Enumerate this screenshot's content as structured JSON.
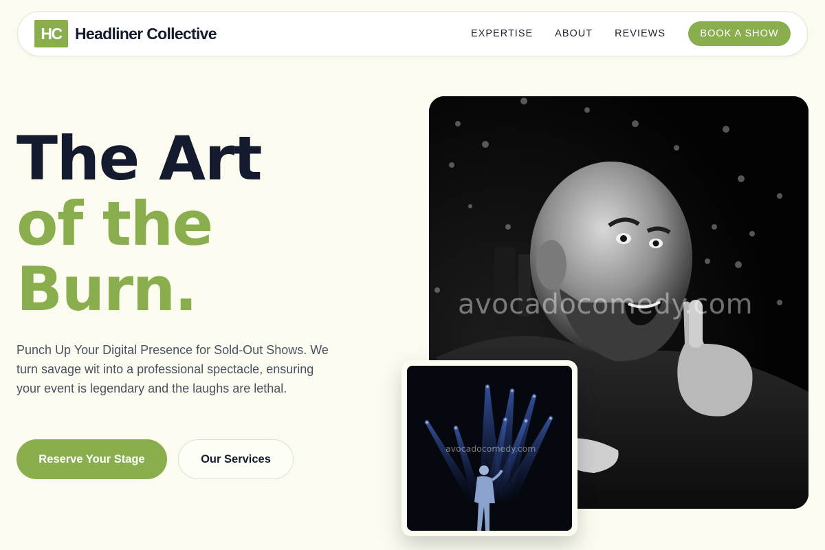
{
  "nav": {
    "logo": "HC",
    "brand": "Headliner Collective",
    "links": [
      "EXPERTISE",
      "ABOUT",
      "REVIEWS"
    ],
    "cta": "BOOK A SHOW"
  },
  "hero": {
    "headline": [
      "The Art",
      "of the",
      "Burn."
    ],
    "subtext": "Punch Up Your Digital Presence for Sold-Out Shows. We turn savage wit into a professional spectacle, ensuring your event is legendary and the laughs are lethal.",
    "primary_button": "Reserve Your Stage",
    "secondary_button": "Our Services"
  },
  "images": {
    "main_watermark": "avocadocomedy.com",
    "inset_watermark": "avocadocomedy.com"
  },
  "colors": {
    "background": "#fbfcef",
    "accent": "#8aae4e",
    "heading": "#141b2e",
    "body_text": "#4a5262"
  }
}
